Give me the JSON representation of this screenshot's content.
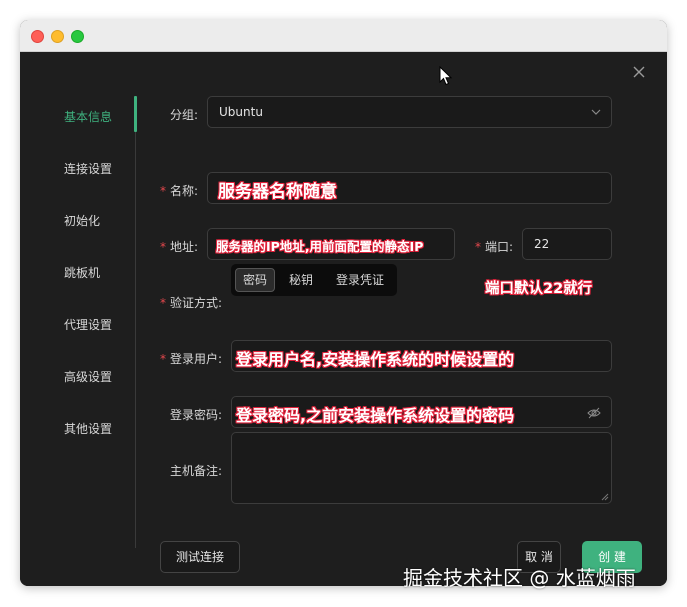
{
  "nav": {
    "items": [
      {
        "label": "基本信息",
        "active": true
      },
      {
        "label": "连接设置",
        "active": false
      },
      {
        "label": "初始化",
        "active": false
      },
      {
        "label": "跳板机",
        "active": false
      },
      {
        "label": "代理设置",
        "active": false
      },
      {
        "label": "高级设置",
        "active": false
      },
      {
        "label": "其他设置",
        "active": false
      }
    ]
  },
  "form": {
    "group": {
      "label": "分组:",
      "value": "Ubuntu"
    },
    "name": {
      "label": "名称:",
      "value": "服务器名称随意"
    },
    "address": {
      "label": "地址:",
      "value": "服务器的IP地址,用前面配置的静态IP"
    },
    "port": {
      "label": "端口:",
      "value": "22"
    },
    "port_note": "端口默认22就行",
    "auth": {
      "label": "验证方式:",
      "options": [
        "密码",
        "秘钥",
        "登录凭证"
      ],
      "selected": "密码"
    },
    "user": {
      "label": "登录用户:",
      "value": "登录用户名,安装操作系统的时候设置的"
    },
    "password": {
      "label": "登录密码:",
      "value": "登录密码,之前安装操作系统设置的密码"
    },
    "remark": {
      "label": "主机备注:",
      "value": ""
    }
  },
  "buttons": {
    "test": "测试连接",
    "cancel": "取 消",
    "create": "创 建"
  },
  "watermark": "掘金技术社区 @ 水蓝烟雨",
  "colors": {
    "accent": "#3fb27f",
    "required": "#e5484d",
    "annotation_outline": "#e0213a",
    "background": "#1e1e1e"
  },
  "icons": [
    "close-icon",
    "chevron-down-icon",
    "eye-off-icon",
    "mouse-cursor-icon"
  ]
}
